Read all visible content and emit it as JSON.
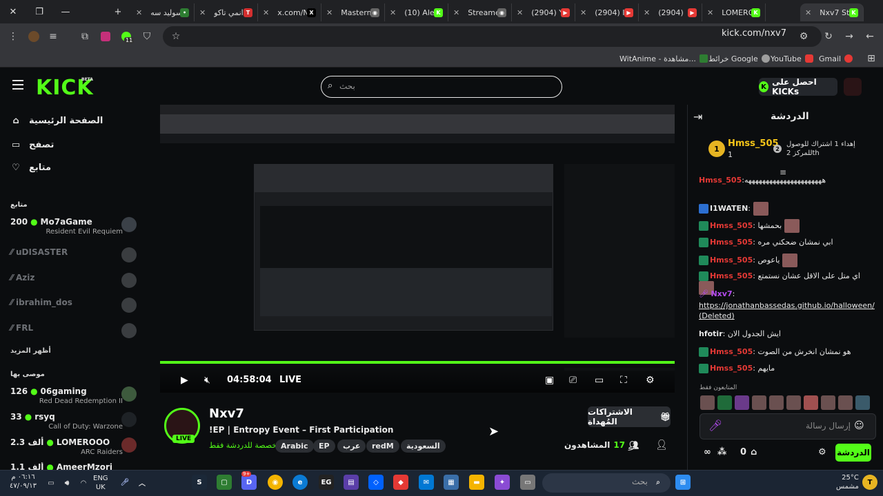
{
  "browser": {
    "tabs": [
      {
        "label": "سوليد سه",
        "color": "#2e7d32",
        "fav": "•"
      },
      {
        "label": "انمي تاكو",
        "color": "#d32f2f",
        "fav": "T"
      },
      {
        "label": "x.com/N",
        "color": "#000000",
        "fav": "X"
      },
      {
        "label": "Masterm",
        "color": "#666666",
        "fav": "◉"
      },
      {
        "label": "(10) Aler",
        "color": "#53fc18",
        "fav": "K"
      },
      {
        "label": "Streame",
        "color": "#666666",
        "fav": "◉"
      },
      {
        "label": "(2904) Y",
        "color": "#e53935",
        "fav": "▶"
      },
      {
        "label": "(2904) I",
        "color": "#e53935",
        "fav": "▶"
      },
      {
        "label": "(2904) ",
        "color": "#e53935",
        "fav": "▶"
      },
      {
        "label": "LOMERO",
        "color": "#53fc18",
        "fav": "K"
      },
      {
        "label": "Nxv7 Str",
        "color": "#53fc18",
        "fav": "K"
      }
    ],
    "url": "kick.com/nxv7",
    "bookmarks": [
      {
        "label": "Gmail",
        "color": "#e53935"
      },
      {
        "label": "YouTube",
        "color": "#e53935"
      },
      {
        "label": "خرائط Google",
        "color": "#9e9e9e"
      },
      {
        "label": "WitAnime - مشاهدة...",
        "color": "#2e7d32"
      }
    ],
    "extension_badge": "11"
  },
  "header": {
    "logo": "KICK",
    "beta": "BETA",
    "search_placeholder": "بحث",
    "get_kicks": "احصل على KICKs"
  },
  "sidebar": {
    "nav": [
      {
        "label": "الصفحة الرئيسية",
        "icon": "⌂"
      },
      {
        "label": "تصفح",
        "icon": "▭"
      },
      {
        "label": "متابع",
        "icon": "♡"
      }
    ],
    "following_title": "متابع",
    "following": [
      {
        "name": "Mo7aGame",
        "viewers": "200",
        "game": "Resident Evil Requiem",
        "live": true
      },
      {
        "name": "uDISASTER",
        "live": false
      },
      {
        "name": "Aziz",
        "live": false
      },
      {
        "name": "ibrahim_dos",
        "live": false
      },
      {
        "name": "FRL",
        "live": false
      }
    ],
    "show_more": "أظهر المزيد",
    "recommended_title": "موصى بها",
    "recommended": [
      {
        "name": "06gaming",
        "viewers": "126",
        "game": "Red Dead Redemption II"
      },
      {
        "name": "rsyq",
        "viewers": "33",
        "game": "Call of Duty: Warzone"
      },
      {
        "name": "LOMEROOO",
        "viewers": "2.3 ألف",
        "game": "ARC Raiders"
      },
      {
        "name": "AmeerMzori",
        "viewers": "1.1 ألف",
        "game": ""
      }
    ]
  },
  "player": {
    "timecode": "04:58:04",
    "live_label": "LIVE",
    "progress": 1.0
  },
  "stream": {
    "streamer": "Nxv7",
    "live_badge": "LIVE",
    "title": "!EP | Entropy Event – First Participation",
    "subs_only": "مخصصة للدردشة فقط",
    "tags": [
      "Arabic",
      "EP",
      "عرب",
      "redM",
      "السعودية"
    ],
    "gift_button": "الاشتراكات المُهداة",
    "viewers_count": "17",
    "viewers_label": "المشاهدون"
  },
  "chat": {
    "title": "الدردشة",
    "leader": {
      "name": "Hmss_505",
      "count": "1",
      "rank1": "1",
      "rank2": "2",
      "goal": "إهداء 1 اشتراك للوصول للمركز 2th"
    },
    "messages": [
      {
        "user": "Hmss_505",
        "text": ":ههههههههههههههههههههههه",
        "color": "#e53935"
      },
      {
        "user": "I1WATEN",
        "text": ":",
        "color": "#ffffff"
      },
      {
        "user": "Hmss_505",
        "text": ": بحمشها",
        "color": "#e53935"
      },
      {
        "user": "Hmss_505",
        "text": ": ابي نمشان ضحكني مره",
        "color": "#e53935"
      },
      {
        "user": "Hmss_505",
        "text": ": ياعوص",
        "color": "#e53935"
      },
      {
        "user": "Hmss_505",
        "text": ": اي متل على الاقل عشان نستمتع",
        "color": "#e53935"
      },
      {
        "user": "Nxv7",
        "text": ":",
        "color": "#b44bf2"
      },
      {
        "user": "",
        "text": "https://jonathanbassedas.github.io/halloween/ (Deleted)",
        "color": "#ffffff"
      },
      {
        "user": "hfotir",
        "text": ": ايش الجدول الان",
        "color": "#ffffff"
      },
      {
        "user": "Hmss_505",
        "text": ": هو نمشان انخرش من الصوت",
        "color": "#e53935"
      },
      {
        "user": "Hmss_505",
        "text": ": مايهم",
        "color": "#e53935"
      }
    ],
    "supporters_label": "المتابعون فقط",
    "input_placeholder": "إرسال رسالة",
    "send_button": "الدردشة",
    "points": "0"
  },
  "taskbar": {
    "time": "٠٦:١٦ م",
    "date": "٤٧/٠٩/١٣",
    "lang": "ENG",
    "region": "UK",
    "search_placeholder": "بحث",
    "temp": "25°C",
    "weather": "مشمس",
    "discord_badge": "9+"
  }
}
